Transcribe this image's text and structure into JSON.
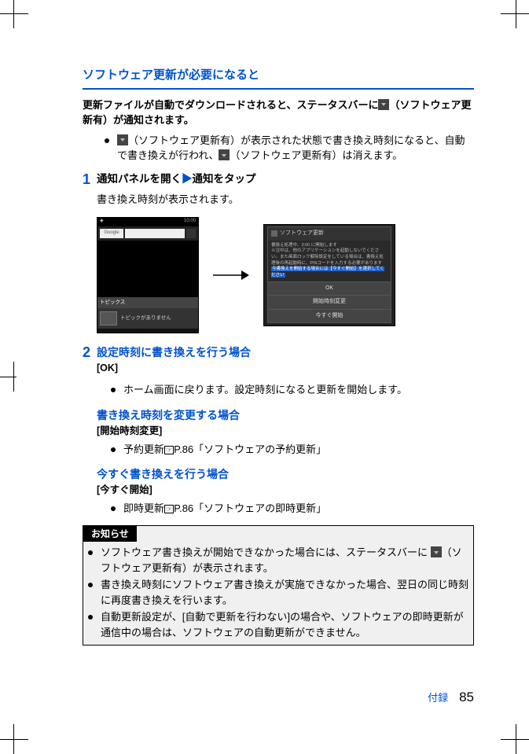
{
  "title": "ソフトウェア更新が必要になると",
  "intro_a": "更新ファイルが自動でダウンロードされると、ステータスバーに",
  "intro_b": "（ソフトウェア更新有）が通知されます。",
  "bullet1_a": "（ソフトウェア更新有）が表示された状態で書き換え時刻になると、自動で書き換えが行われ、",
  "bullet1_b": "（ソフトウェア更新有）は消えます。",
  "step1": {
    "num": "1",
    "head_a": "通知パネルを開く",
    "tri": "▶",
    "head_b": "通知をタップ",
    "body": "書き換え時刻が表示されます。"
  },
  "shot_left": {
    "time": "10:00",
    "logo": "Google",
    "panel_label": "トピックス",
    "panel_item": "トピックがありません"
  },
  "shot_right": {
    "title": "ソフトウェア更新",
    "line1": "書換え処理中、3:00 に開始します",
    "line2": "※注中は、他のアプリケーションを起動しないでください。また画面ロック解除設定をしている場合は、書換え処理後の再起動時に、PINコードを入力する必要があります",
    "line_hl": "今書換えを開始する場合には【今すぐ開始】を選択してください",
    "btn_ok": "OK",
    "btn_change": "開始時刻変更",
    "btn_now": "今すぐ開始"
  },
  "step2": {
    "num": "2",
    "head": "設定時刻に書き換えを行う場合",
    "bracket": "[OK]",
    "bullet": "ホーム画面に戻ります。設定時刻になると更新を開始します。"
  },
  "case_change": {
    "head": "書き換え時刻を変更する場合",
    "bracket": "[開始時刻変更]",
    "bullet_a": "予約更新",
    "bullet_b": "P.86「ソフトウェアの予約更新」"
  },
  "case_now": {
    "head": "今すぐ書き換えを行う場合",
    "bracket": "[今すぐ開始]",
    "bullet_a": "即時更新",
    "bullet_b": "P.86「ソフトウェアの即時更新」"
  },
  "notice": {
    "label": "お知らせ",
    "n1_a": "ソフトウェア書き換えが開始できなかった場合には、ステータスバーに",
    "n1_b": "（ソフトウェア更新有）が表示されます。",
    "n2": "書き換え時刻にソフトウェア書き換えが実施できなかった場合、翌日の同じ時刻に再度書き換えを行います。",
    "n3": "自動更新設定が、[自動で更新を行わない]の場合や、ソフトウェアの即時更新が通信中の場合は、ソフトウェアの自動更新ができません。"
  },
  "footer": {
    "section": "付録",
    "page": "85"
  },
  "ref_icon": "☞"
}
